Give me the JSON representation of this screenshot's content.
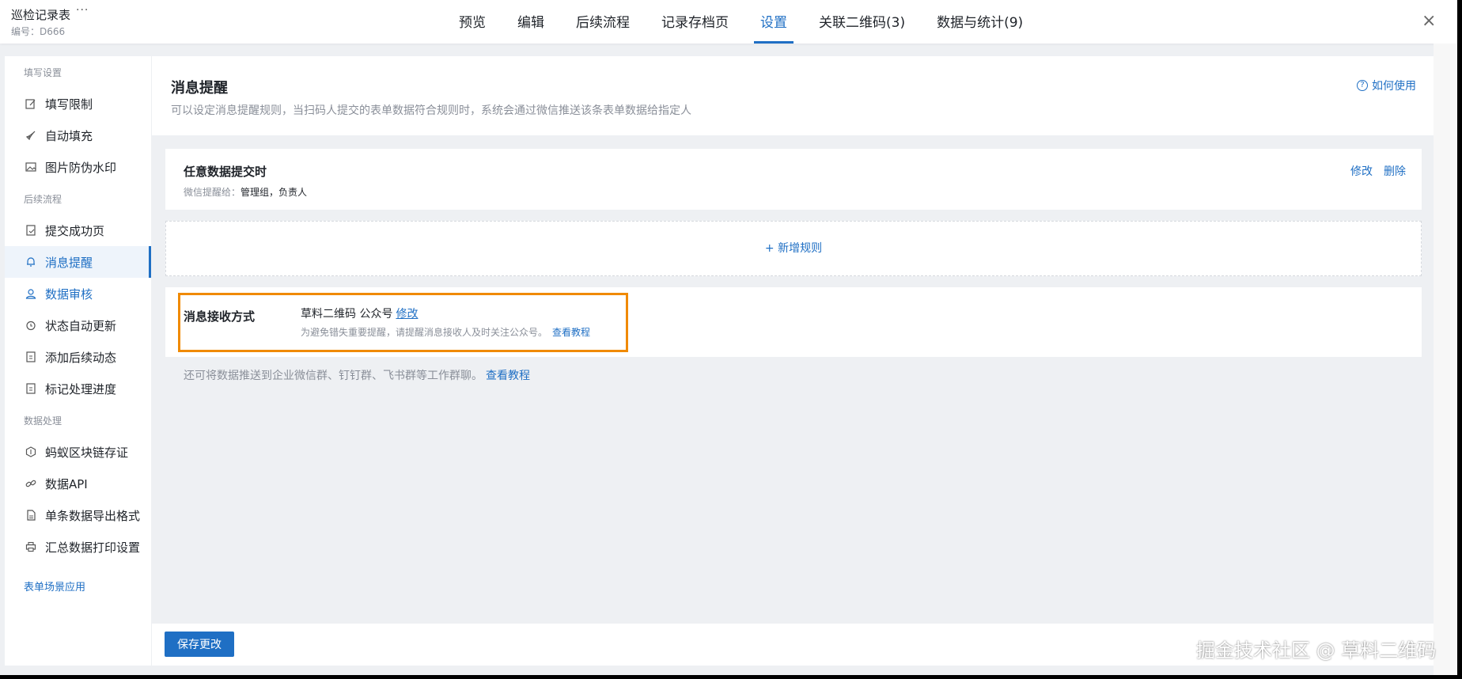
{
  "header": {
    "doc_title": "巡检记录表",
    "more_label": "···",
    "doc_id": "编号：D666",
    "tabs": [
      {
        "label": "预览"
      },
      {
        "label": "编辑"
      },
      {
        "label": "后续流程"
      },
      {
        "label": "记录存档页"
      },
      {
        "label": "设置"
      },
      {
        "label": "关联二维码(3)"
      },
      {
        "label": "数据与统计(9)"
      }
    ],
    "active_tab": "设置",
    "close_label": "×"
  },
  "sidebar": {
    "group_fill": "填写设置",
    "group_flow": "后续流程",
    "group_data": "数据处理",
    "items": [
      {
        "label": "填写限制",
        "icon": "edit-icon"
      },
      {
        "label": "自动填充",
        "icon": "rocket-icon"
      },
      {
        "label": "图片防伪水印",
        "icon": "image-icon"
      },
      {
        "label": "提交成功页",
        "icon": "page-check-icon"
      },
      {
        "label": "消息提醒",
        "icon": "bell-icon"
      },
      {
        "label": "数据审核",
        "icon": "user-icon"
      },
      {
        "label": "状态自动更新",
        "icon": "clock-icon"
      },
      {
        "label": "添加后续动态",
        "icon": "doc-icon"
      },
      {
        "label": "标记处理进度",
        "icon": "doc-icon"
      },
      {
        "label": "蚂蚁区块链存证",
        "icon": "chain-icon"
      },
      {
        "label": "数据API",
        "icon": "link-icon"
      },
      {
        "label": "单条数据导出格式",
        "icon": "file-icon"
      },
      {
        "label": "汇总数据打印设置",
        "icon": "printer-icon"
      }
    ],
    "footer_link": "表单场景应用"
  },
  "main": {
    "title": "消息提醒",
    "description": "可以设定消息提醒规则，当扫码人提交的表单数据符合规则时，系统会通过微信推送该条表单数据给指定人",
    "howto": "如何使用",
    "rule": {
      "title": "任意数据提交时",
      "recipients_prefix": "微信提醒给：",
      "recipients": "管理组，负责人",
      "edit": "修改",
      "delete": "删除"
    },
    "add_rule": "+ 新增规则",
    "receive": {
      "label": "消息接收方式",
      "value": "草料二维码 公众号",
      "edit": "修改",
      "tip": "为避免错失重要提醒，请提醒消息接收人及时关注公众号。",
      "tip_link": "查看教程"
    },
    "push_note": "还可将数据推送到企业微信群、钉钉群、飞书群等工作群聊。",
    "push_link": "查看教程"
  },
  "footer": {
    "save": "保存更改"
  },
  "watermark": "掘金技术社区 @ 草料二维码",
  "colors": {
    "accent": "#1f6fc4",
    "highlight": "#f08a00"
  }
}
